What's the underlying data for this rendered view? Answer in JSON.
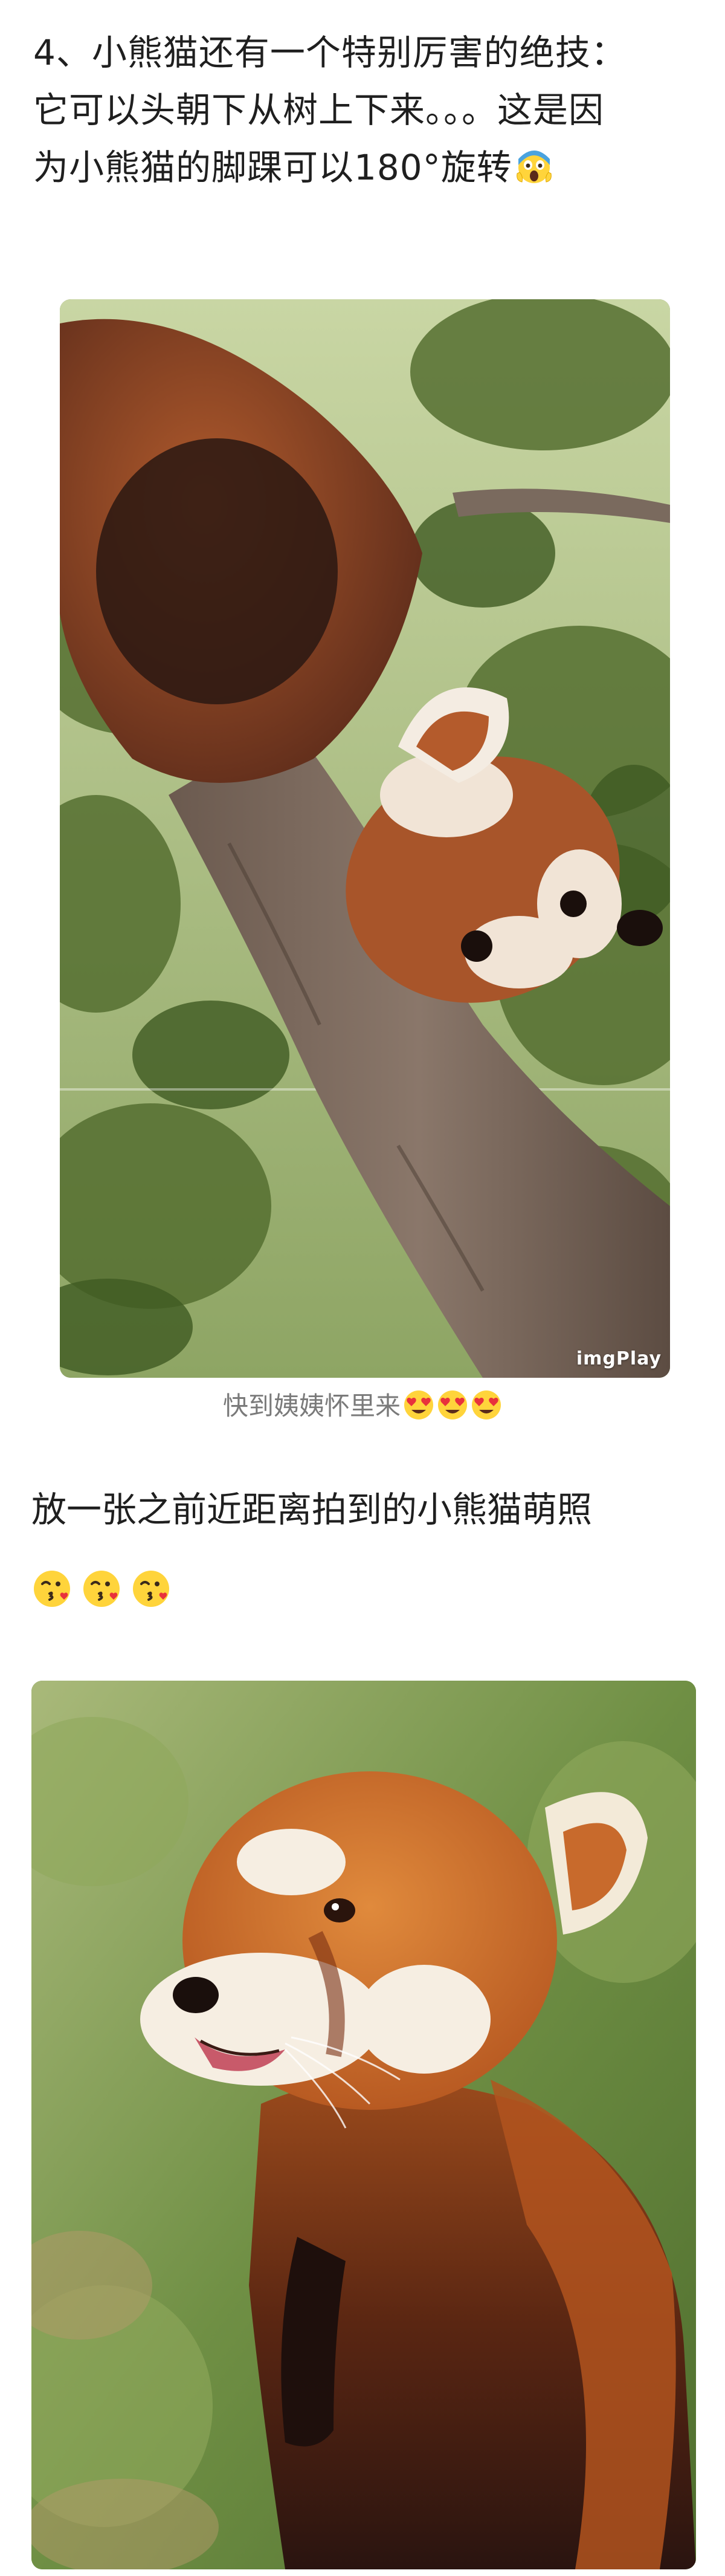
{
  "post": {
    "paragraph1": {
      "line1": "4、小熊猫还有一个特别厉害的绝技：",
      "line2": "它可以头朝下从树上下来。。。这是因",
      "line3": "为小熊猫的脚踝可以180°旋转",
      "emoji": "screaming-face-icon"
    },
    "photo1": {
      "alt": "red-panda-climbing-down-tree",
      "watermark": "imgPlay"
    },
    "caption": {
      "text": "快到姨姨怀里来",
      "emojis": [
        "heart-eyes-icon",
        "heart-eyes-icon",
        "heart-eyes-icon"
      ]
    },
    "paragraph2": {
      "line1": "放一张之前近距离拍到的小熊猫萌照",
      "emojis": [
        "kissing-heart-icon",
        "kissing-heart-icon",
        "kissing-heart-icon"
      ]
    },
    "photo2": {
      "alt": "red-panda-closeup-portrait"
    }
  },
  "colors": {
    "text": "#1f1f1f",
    "caption": "#7a7a7a",
    "background": "#ffffff"
  }
}
